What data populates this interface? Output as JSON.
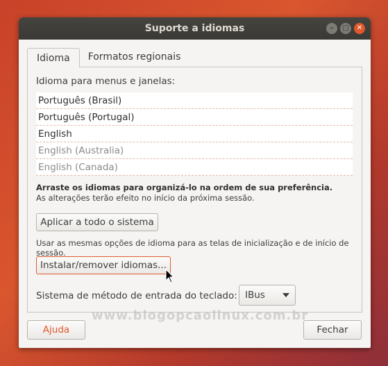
{
  "window": {
    "title": "Suporte a idiomas",
    "controls": [
      "minimize-icon",
      "maximize-icon",
      "close-icon"
    ]
  },
  "tabs": [
    {
      "label": "Idioma",
      "active": true
    },
    {
      "label": "Formatos regionais",
      "active": false
    }
  ],
  "language": {
    "list_label": "Idioma para menus e janelas:",
    "items": [
      {
        "label": "Português (Brasil)",
        "enabled": true
      },
      {
        "label": "Português (Portugal)",
        "enabled": true
      },
      {
        "label": "English",
        "enabled": true
      },
      {
        "label": "English (Australia)",
        "enabled": false
      },
      {
        "label": "English (Canada)",
        "enabled": false
      }
    ],
    "drag_hint": "Arraste os idiomas para organizá-lo na ordem de sua preferência.",
    "restart_hint": "As alterações terão efeito no início da próxima sessão.",
    "apply_button": "Aplicar a todo o sistema",
    "apply_hint": "Usar as mesmas opções de idioma para as telas de inicialização e de início de sessão.",
    "install_button": "Instalar/remover idiomas...",
    "ime_label": "Sistema de método de entrada do teclado:",
    "ime_value": "IBus"
  },
  "footer": {
    "help_button": "Ajuda",
    "close_button": "Fechar"
  },
  "watermark": "www.blogopcaolinux.com.br",
  "colors": {
    "accent": "#e2582d",
    "titlebar": "#3c3b37",
    "background": "#f5f4f2"
  }
}
